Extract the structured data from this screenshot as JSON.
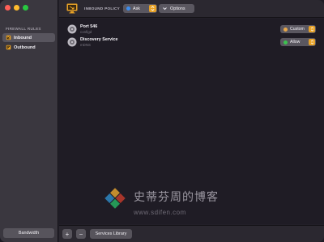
{
  "sidebar": {
    "section_title": "FIREWALL RULES",
    "items": [
      {
        "label": "Inbound",
        "icon": "inbound-shield-icon",
        "selected": true
      },
      {
        "label": "Outbound",
        "icon": "outbound-shield-icon",
        "selected": false
      }
    ],
    "bottom_button": "Bandwidth"
  },
  "toolbar": {
    "app_icon": "monitor-arrow-icon",
    "title": "INBOUND POLICY",
    "policy": {
      "value": "Ask",
      "dot_color": "#3d8ef0"
    },
    "options_label": "Options"
  },
  "rules": [
    {
      "name": "Port 546",
      "sub": "configd",
      "action": "Custom",
      "dot_color": "#e8a84a"
    },
    {
      "name": "Discovery Service",
      "sub": "mDNS",
      "action": "Allow",
      "dot_color": "#3cc24f"
    }
  ],
  "bottombar": {
    "add_label": "+",
    "remove_label": "−",
    "services_label": "Services Library"
  },
  "watermark": {
    "cn_text": "史蒂芬周的博客",
    "url": "www.sdifen.com"
  },
  "colors": {
    "accent_orange": "#e8a226",
    "sidebar_bg": "#3a373f",
    "main_bg": "#1f1c25"
  }
}
